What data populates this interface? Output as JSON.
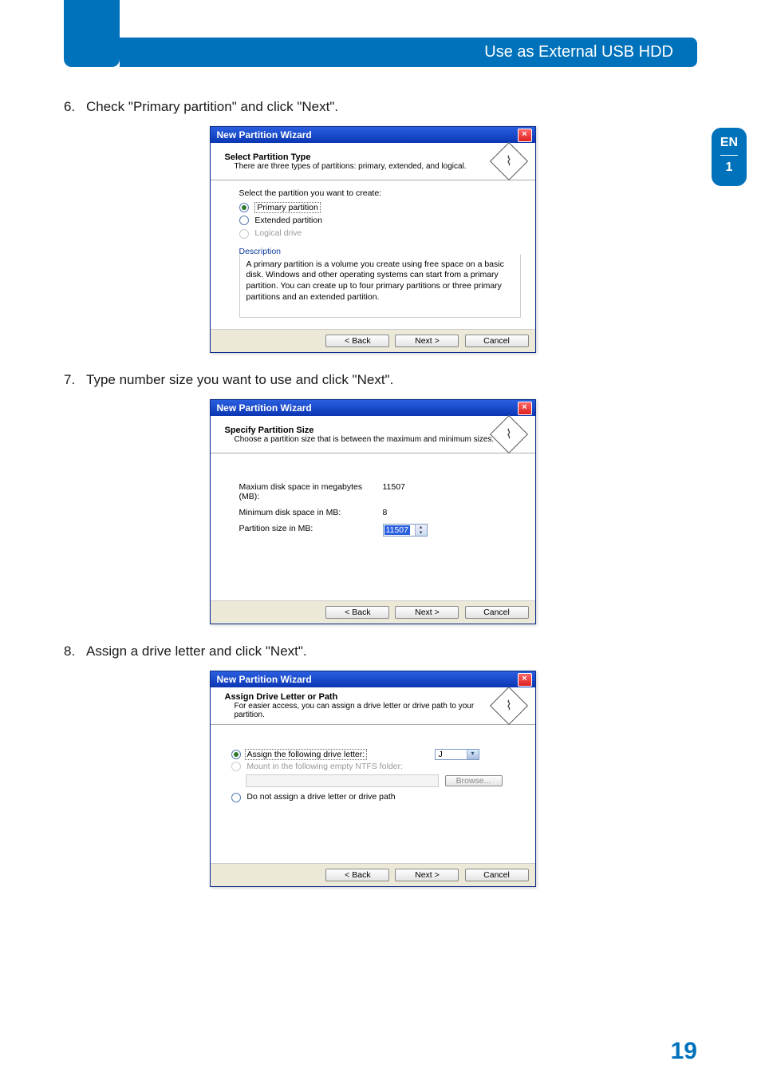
{
  "header": {
    "title": "Use as External USB HDD"
  },
  "side_tab": {
    "lang": "EN",
    "section": "1"
  },
  "page_number": "19",
  "steps": [
    {
      "num": "6.",
      "text": "Check \"Primary partition\" and click \"Next\"."
    },
    {
      "num": "7.",
      "text": "Type number size you want to use and click \"Next\"."
    },
    {
      "num": "8.",
      "text": "Assign a drive letter and click \"Next\"."
    }
  ],
  "dlg": {
    "title": "New Partition Wizard",
    "close": "×",
    "back": "< Back",
    "next": "Next >",
    "cancel": "Cancel"
  },
  "d1": {
    "head_title": "Select Partition Type",
    "head_sub": "There are three types of partitions: primary, extended, and logical.",
    "prompt": "Select the partition you want to create:",
    "opt_primary": "Primary partition",
    "opt_extended": "Extended partition",
    "opt_logical": "Logical drive",
    "desc_label": "Description",
    "desc_text": "A primary partition is a volume you create using free space on a basic disk. Windows and other operating systems can start from a primary partition. You can create up to four primary partitions or three primary partitions and an extended partition."
  },
  "d2": {
    "head_title": "Specify Partition Size",
    "head_sub": "Choose a partition size that is between the maximum and minimum sizes.",
    "max_lbl": "Maxium disk space in megabytes (MB):",
    "max_val": "11507",
    "min_lbl": "Minimum disk space in MB:",
    "min_val": "8",
    "size_lbl": "Partition size in MB:",
    "size_val": "11507"
  },
  "d3": {
    "head_title": "Assign Drive Letter or Path",
    "head_sub": "For easier access, you can assign a drive letter or drive path to your partition.",
    "opt_assign": "Assign the following drive letter:",
    "drive_letter": "J",
    "opt_mount": "Mount in the following empty NTFS folder:",
    "browse": "Browse...",
    "opt_none": "Do not assign a drive letter or drive path"
  }
}
